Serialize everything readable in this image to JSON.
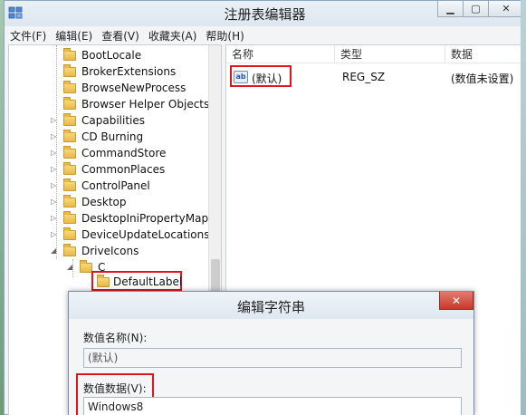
{
  "window": {
    "title": "注册表编辑器"
  },
  "menu": {
    "items": [
      "文件(F)",
      "编辑(E)",
      "查看(V)",
      "收藏夹(A)",
      "帮助(H)"
    ]
  },
  "tree": {
    "items": [
      {
        "label": "BootLocale",
        "expandable": false
      },
      {
        "label": "BrokerExtensions",
        "expandable": false
      },
      {
        "label": "BrowseNewProcess",
        "expandable": false
      },
      {
        "label": "Browser Helper Objects",
        "expandable": false
      },
      {
        "label": "Capabilities",
        "expandable": true
      },
      {
        "label": "CD Burning",
        "expandable": true
      },
      {
        "label": "CommandStore",
        "expandable": true
      },
      {
        "label": "CommonPlaces",
        "expandable": true
      },
      {
        "label": "ControlPanel",
        "expandable": true
      },
      {
        "label": "Desktop",
        "expandable": true
      },
      {
        "label": "DesktopIniPropertyMap",
        "expandable": true
      },
      {
        "label": "DeviceUpdateLocations",
        "expandable": true
      },
      {
        "label": "DriveIcons",
        "expandable": true
      },
      {
        "label": "C",
        "expandable": true
      },
      {
        "label": "DefaultLabel",
        "expandable": false
      }
    ]
  },
  "values": {
    "headers": {
      "name": "名称",
      "type": "类型",
      "data": "数据"
    },
    "rows": [
      {
        "name": "(默认)",
        "type": "REG_SZ",
        "data": "(数值未设置)",
        "icon": "string-value-icon"
      }
    ]
  },
  "dialog": {
    "title": "编辑字符串",
    "close_label": "✕",
    "name_label": "数值名称(N):",
    "name_value": "(默认)",
    "data_label": "数值数据(V):",
    "data_value": "Windows8"
  },
  "colors": {
    "highlight": "#e2141c",
    "folder": "#e8b84a"
  }
}
